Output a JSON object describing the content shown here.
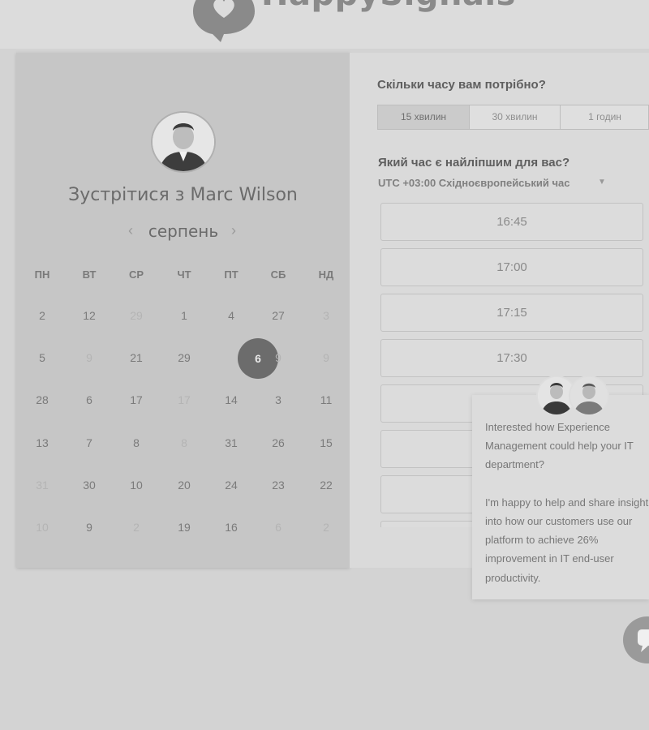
{
  "header": {
    "logo_text": "HappySignals"
  },
  "booking": {
    "title": "Зустрітися з Marc Wilson",
    "month": "серпень",
    "weekdays": [
      "ПН",
      "ВТ",
      "СР",
      "ЧТ",
      "ПТ",
      "СБ",
      "НД"
    ],
    "weeks": [
      [
        "2",
        "12",
        "29",
        "1",
        "4",
        "27",
        "3"
      ],
      [
        "5",
        "9",
        "21",
        "29",
        "6",
        "9",
        "9"
      ],
      [
        "28",
        "6",
        "17",
        "17",
        "14",
        "3",
        "11"
      ],
      [
        "13",
        "7",
        "8",
        "8",
        "31",
        "26",
        "15"
      ],
      [
        "31",
        "30",
        "10",
        "20",
        "24",
        "23",
        "22"
      ],
      [
        "10",
        "9",
        "2",
        "19",
        "16",
        "6",
        "2"
      ]
    ],
    "disabled": [
      [
        false,
        false,
        true,
        false,
        false,
        false,
        true
      ],
      [
        false,
        true,
        false,
        false,
        false,
        true,
        true
      ],
      [
        false,
        false,
        false,
        true,
        false,
        false,
        false
      ],
      [
        false,
        false,
        false,
        true,
        false,
        false,
        false
      ],
      [
        true,
        false,
        false,
        false,
        false,
        false,
        false
      ],
      [
        true,
        false,
        true,
        false,
        false,
        true,
        true
      ]
    ],
    "selected_day": "6"
  },
  "duration": {
    "question": "Скільки часу вам потрібно?",
    "options": [
      "15 хвилин",
      "30 хвилин",
      "1 годин"
    ],
    "active_index": 0
  },
  "time": {
    "question": "Який час є найліпшим для вас?",
    "timezone": "UTC +03:00 Східноєвропейський час",
    "slots": [
      "16:45",
      "17:00",
      "17:15",
      "17:30",
      "",
      "",
      "",
      ""
    ]
  },
  "chat": {
    "message": "Interested how Experience Management could help your IT department?\n\nI'm happy to help and share insight into how our customers use our platform to achieve 26% improvement in IT end-user productivity."
  }
}
